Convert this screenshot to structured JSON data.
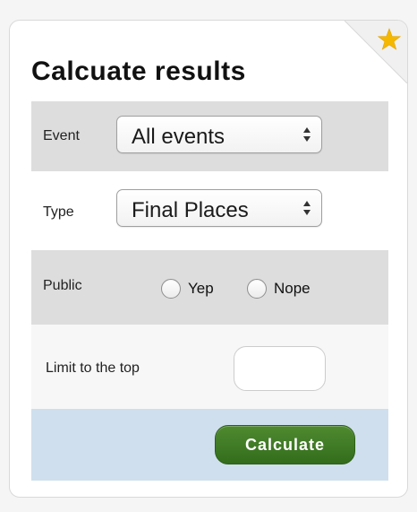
{
  "title": "Calcuate results",
  "event": {
    "label": "Event",
    "selected": "All events"
  },
  "type": {
    "label": "Type",
    "selected": "Final Places"
  },
  "public": {
    "label": "Public",
    "option_yes": "Yep",
    "option_no": "Nope"
  },
  "limit": {
    "label": "Limit to the top",
    "value": ""
  },
  "actions": {
    "calculate_label": "Calculate"
  },
  "colors": {
    "star": "#f5b800",
    "button_green": "#3f7a24",
    "row_gray": "#dddddd",
    "row_blue": "#cfdfee"
  },
  "icons": {
    "corner": "star-icon",
    "select_arrows": "up-down-arrows-icon"
  }
}
